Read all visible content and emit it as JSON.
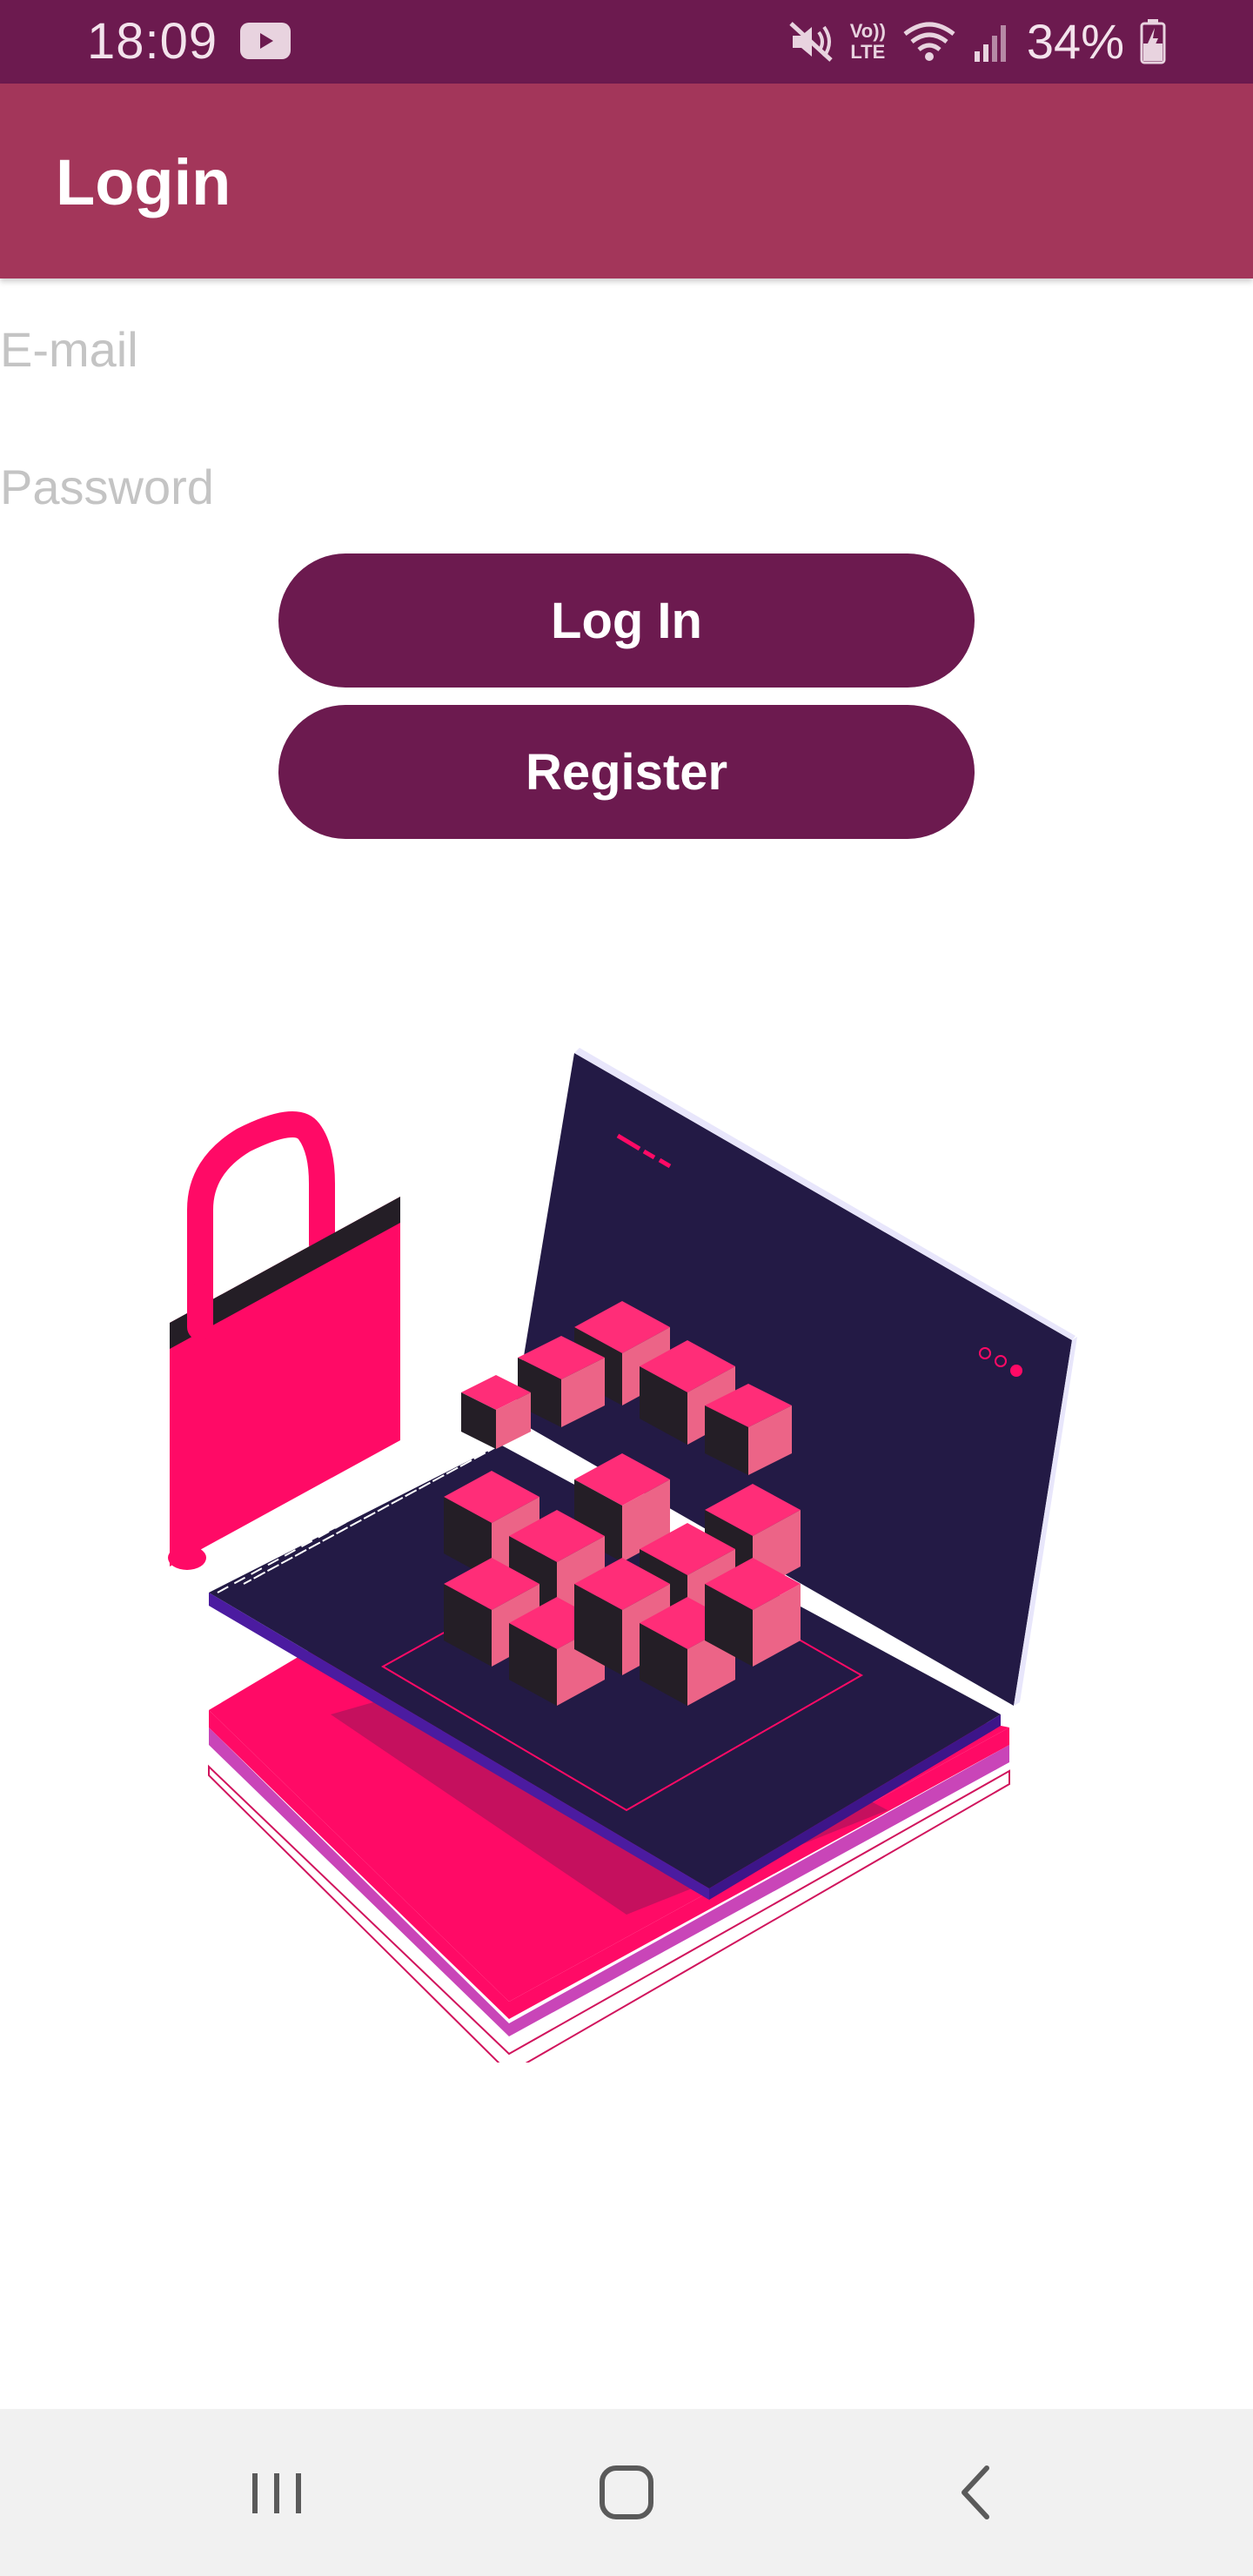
{
  "status_bar": {
    "time": "18:09",
    "notification_icon": "youtube-icon",
    "icons": [
      "mute-icon",
      "volte-icon",
      "wifi-icon",
      "signal-icon"
    ],
    "volte_label_top": "Vo))",
    "volte_label_bottom": "LTE",
    "battery_percent": "34%",
    "battery_icon": "battery-charging-icon"
  },
  "app_bar": {
    "title": "Login"
  },
  "form": {
    "email_placeholder": "E-mail",
    "password_placeholder": "Password",
    "login_label": "Log In",
    "register_label": "Register"
  },
  "illustration": {
    "description_icon": "laptop-padlock-cubes-illustration"
  },
  "nav_bar": {
    "recents_icon": "recents-icon",
    "home_icon": "home-icon",
    "back_icon": "back-icon"
  },
  "colors": {
    "status_bar": "#6c1a4f",
    "app_bar": "#a3365a",
    "button": "#6c1a4f",
    "accent_pink": "#ff0a66",
    "laptop_screen": "#231a45"
  }
}
